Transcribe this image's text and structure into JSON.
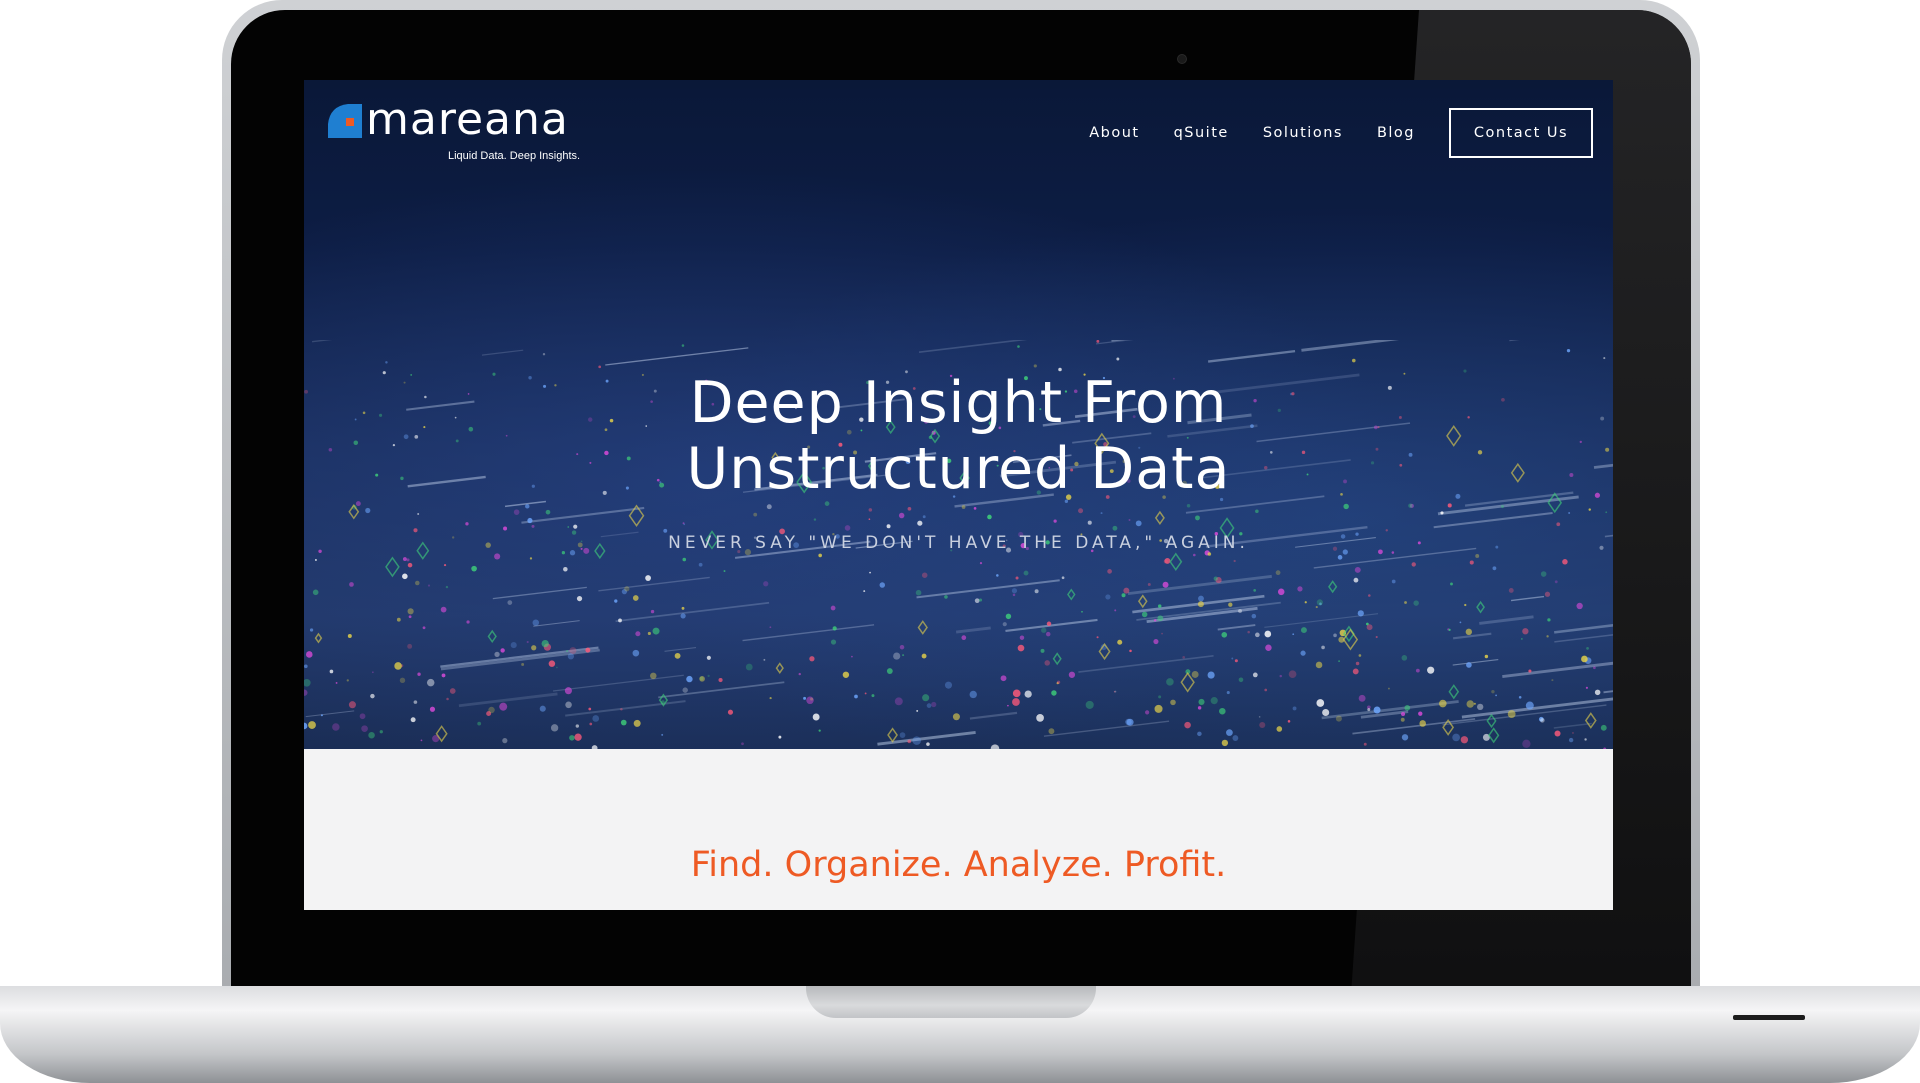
{
  "brand": {
    "name": "mareana",
    "tagline": "Liquid Data. Deep Insights.",
    "mark_color_blue": "#1f7fd1",
    "mark_color_orange": "#ee5a24"
  },
  "nav": {
    "links": [
      {
        "label": "About"
      },
      {
        "label": "qSuite"
      },
      {
        "label": "Solutions"
      },
      {
        "label": "Blog"
      }
    ],
    "cta": "Contact Us"
  },
  "hero": {
    "title_line1": "Deep Insight From",
    "title_line2": "Unstructured Data",
    "subtitle": "NEVER SAY \"WE DON'T HAVE THE DATA,\" AGAIN."
  },
  "section": {
    "heading": "Find. Organize. Analyze. Profit.",
    "heading_color": "#ee5a24"
  }
}
